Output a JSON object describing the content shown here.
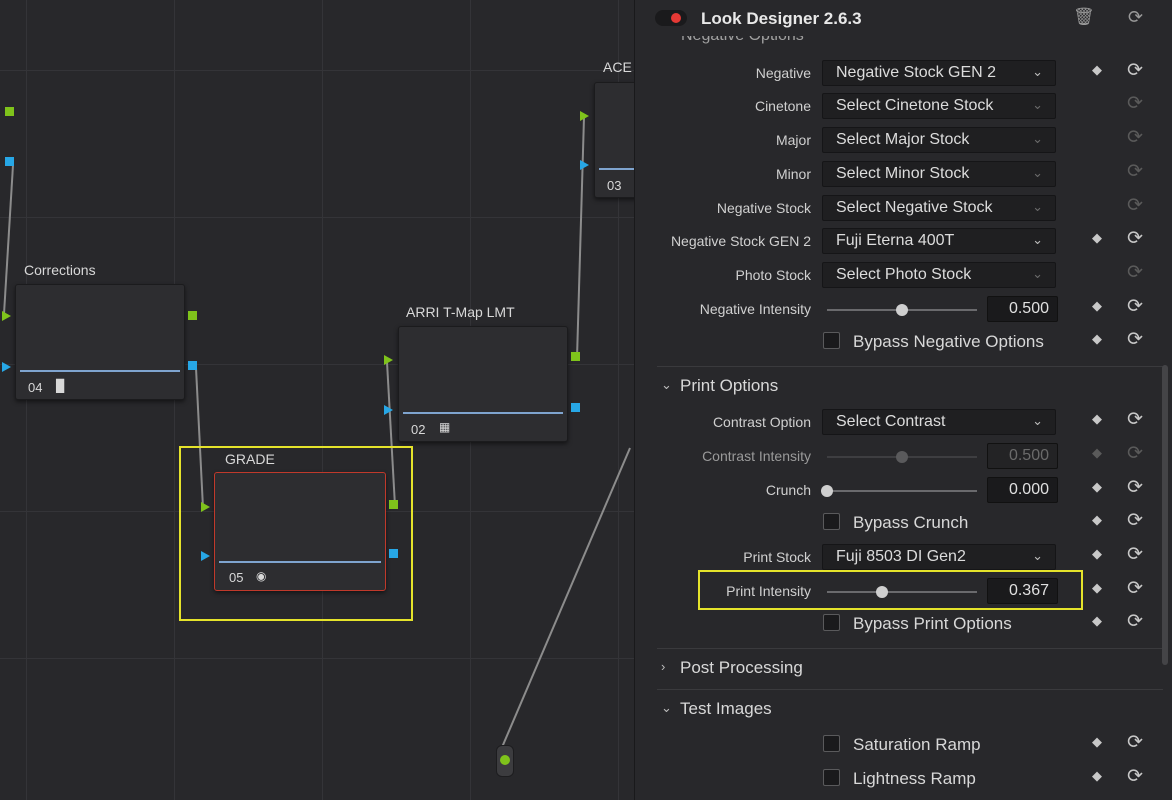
{
  "graph": {
    "nodes": [
      {
        "id": "corrections",
        "title": "Corrections",
        "num": "04",
        "icon": "bars-icon"
      },
      {
        "id": "arri",
        "title": "ARRI T-Map LMT",
        "num": "02",
        "icon": "lut-grid-icon"
      },
      {
        "id": "grade",
        "title": "GRADE",
        "num": "05",
        "icon": "plugin-icon"
      },
      {
        "id": "ace",
        "title": "ACE",
        "num": "03"
      }
    ]
  },
  "panel": {
    "title": "Look Designer 2.6.3",
    "clipped_section": "Negative Options",
    "negative_rows": [
      {
        "label": "Negative",
        "value": "Negative Stock GEN 2",
        "enabled": true
      },
      {
        "label": "Cinetone",
        "value": "Select Cinetone Stock",
        "enabled": false
      },
      {
        "label": "Major",
        "value": "Select Major Stock",
        "enabled": false
      },
      {
        "label": "Minor",
        "value": "Select Minor Stock",
        "enabled": false
      },
      {
        "label": "Negative Stock",
        "value": "Select Negative Stock",
        "enabled": false
      },
      {
        "label": "Negative Stock GEN 2",
        "value": "Fuji Eterna 400T",
        "enabled": true
      },
      {
        "label": "Photo Stock",
        "value": "Select Photo Stock",
        "enabled": false
      }
    ],
    "negative_intensity": {
      "label": "Negative Intensity",
      "value": "0.500",
      "fraction": 0.5
    },
    "bypass_negative": {
      "label": "Bypass Negative Options",
      "checked": false
    },
    "print_options": {
      "title": "Print Options",
      "contrast_option": {
        "label": "Contrast Option",
        "value": "Select Contrast"
      },
      "contrast_intensity": {
        "label": "Contrast Intensity",
        "value": "0.500",
        "fraction": 0.5
      },
      "crunch": {
        "label": "Crunch",
        "value": "0.000",
        "fraction": 0.0
      },
      "bypass_crunch": {
        "label": "Bypass Crunch",
        "checked": false
      },
      "print_stock": {
        "label": "Print Stock",
        "value": "Fuji 8503 DI Gen2"
      },
      "print_intensity": {
        "label": "Print Intensity",
        "value": "0.367",
        "fraction": 0.367
      },
      "bypass_print": {
        "label": "Bypass Print Options",
        "checked": false
      }
    },
    "post_processing": {
      "title": "Post Processing"
    },
    "test_images": {
      "title": "Test Images",
      "saturation_ramp": {
        "label": "Saturation Ramp",
        "checked": false
      },
      "lightness_ramp": {
        "label": "Lightness Ramp",
        "checked": false
      }
    },
    "icons": {
      "trash": "trash-icon",
      "reset": "reset-icon",
      "keyframe": "diamond-icon",
      "chevron": "chevron-down-icon"
    }
  }
}
